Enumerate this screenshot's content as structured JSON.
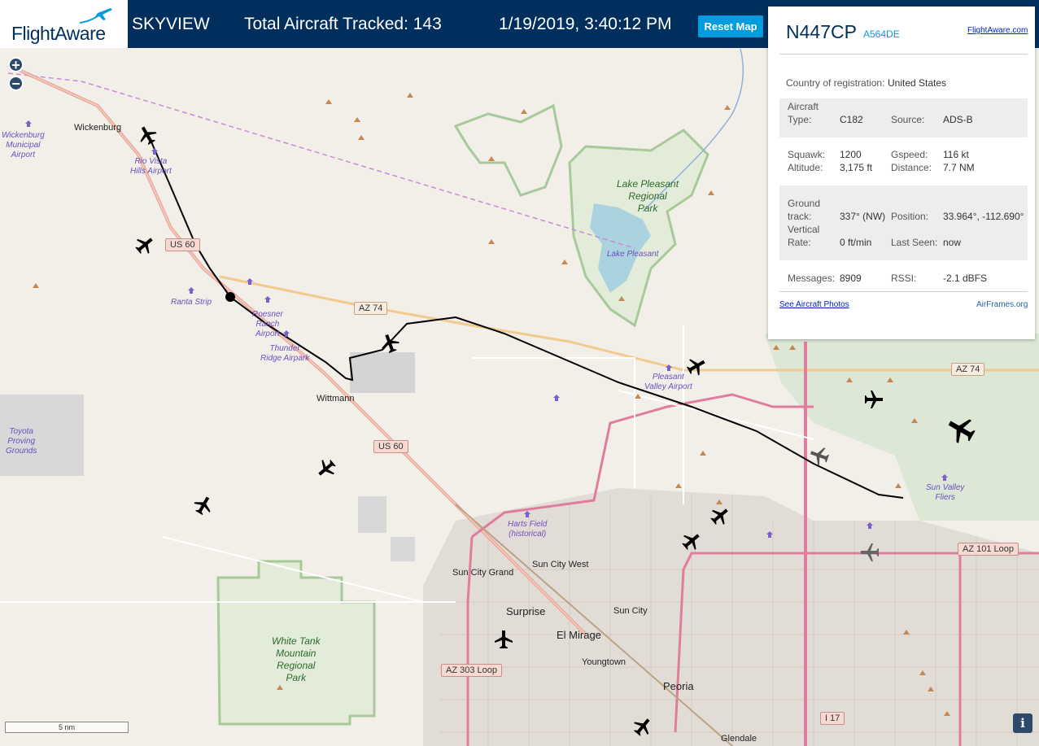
{
  "header": {
    "logo": "FlightAware",
    "title": "SKYVIEW",
    "aircraft_tracked": "Total Aircraft Tracked: 143",
    "datetime": "1/19/2019, 3:40:12 PM",
    "reset_label": "Reset Map"
  },
  "map": {
    "zoom_in": "+",
    "zoom_out": "−",
    "scale_label": "5 nm",
    "info": "i",
    "labels": {
      "wickenburg": "Wickenburg",
      "wickenburg_airport": "Wickenburg\nMunicipal\nAirport",
      "rio_vista": "Rio Vista\nHills Airport",
      "ranta": "Ranta Strip",
      "roesner": "Roesner\nRanch\nAirport",
      "thunder": "Thunder\nRidge Airpark",
      "wittmann": "Wittmann",
      "toyota": "Toyota\nProving\nGrounds",
      "lake_pleasant_park": "Lake Pleasant\nRegional\nPark",
      "lake_pleasant": "Lake Pleasant",
      "pleasant_valley": "Pleasant\nValley Airport",
      "sun_valley": "Sun Valley\nFliers",
      "harts_field": "Harts Field\n(historical)",
      "sun_city_grand": "Sun City Grand",
      "sun_city_west": "Sun City West",
      "surprise": "Surprise",
      "el_mirage": "El Mirage",
      "sun_city": "Sun City",
      "youngtown": "Youngtown",
      "peoria": "Peoria",
      "glendale": "Glendale",
      "white_tank": "White Tank\nMountain\nRegional\nPark"
    },
    "shields": {
      "us60_a": "US 60",
      "us60_b": "US 60",
      "az74_a": "AZ 74",
      "az74_b": "AZ 74",
      "az303": "AZ 303 Loop",
      "az101": "AZ 101 Loop",
      "i17": "I 17"
    }
  },
  "panel": {
    "tail": "N447CP",
    "hex": "A564DE",
    "fa_link": "FlightAware.com",
    "country_label": "Country of registration:",
    "country": "United States",
    "aircraft_type_label": "Aircraft\nType:",
    "aircraft_type": "C182",
    "source_label": "Source:",
    "source": "ADS-B",
    "squawk_label": "Squawk:",
    "squawk": "1200",
    "gspeed_label": "Gspeed:",
    "gspeed": "116 kt",
    "altitude_label": "Altitude:",
    "altitude": "3,175 ft",
    "distance_label": "Distance:",
    "distance": "7.7 NM",
    "ground_track_label": "Ground\ntrack:",
    "ground_track": "337° (NW)",
    "position_label": "Position:",
    "position": "33.964°, -112.690°",
    "vertical_rate_label": "Vertical\nRate:",
    "vertical_rate": "0 ft/min",
    "last_seen_label": "Last Seen:",
    "last_seen": "now",
    "messages_label": "Messages:",
    "messages": "8909",
    "rssi_label": "RSSI:",
    "rssi": "-2.1 dBFS",
    "photos_link": "See Aircraft Photos",
    "airframes_link": "AirFrames.org"
  }
}
